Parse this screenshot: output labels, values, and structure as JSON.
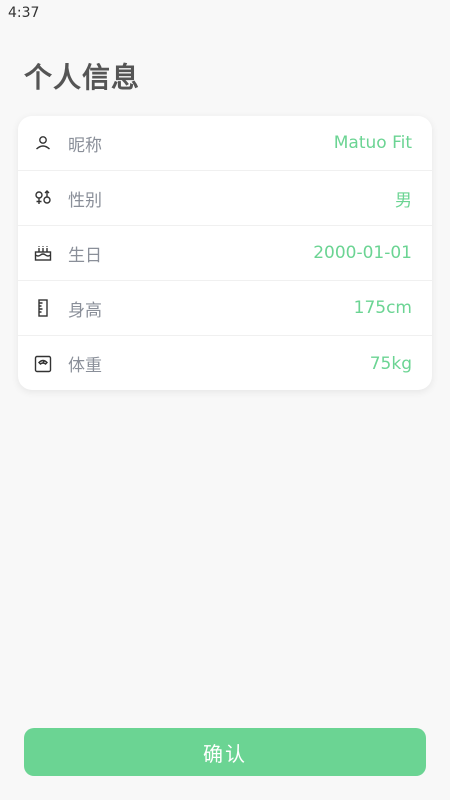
{
  "status_bar": {
    "time": "4:37"
  },
  "page": {
    "title": "个人信息"
  },
  "profile": {
    "rows": [
      {
        "icon": "user-icon",
        "label": "昵称",
        "value": "Matuo Fit"
      },
      {
        "icon": "gender-icon",
        "label": "性别",
        "value": "男"
      },
      {
        "icon": "cake-icon",
        "label": "生日",
        "value": "2000-01-01"
      },
      {
        "icon": "ruler-icon",
        "label": "身高",
        "value": "175cm"
      },
      {
        "icon": "scale-icon",
        "label": "体重",
        "value": "75kg"
      }
    ]
  },
  "actions": {
    "confirm_label": "确认"
  },
  "colors": {
    "accent": "#6bd493",
    "label": "#8a8f99",
    "title": "#555555",
    "background": "#f8f8f8"
  }
}
